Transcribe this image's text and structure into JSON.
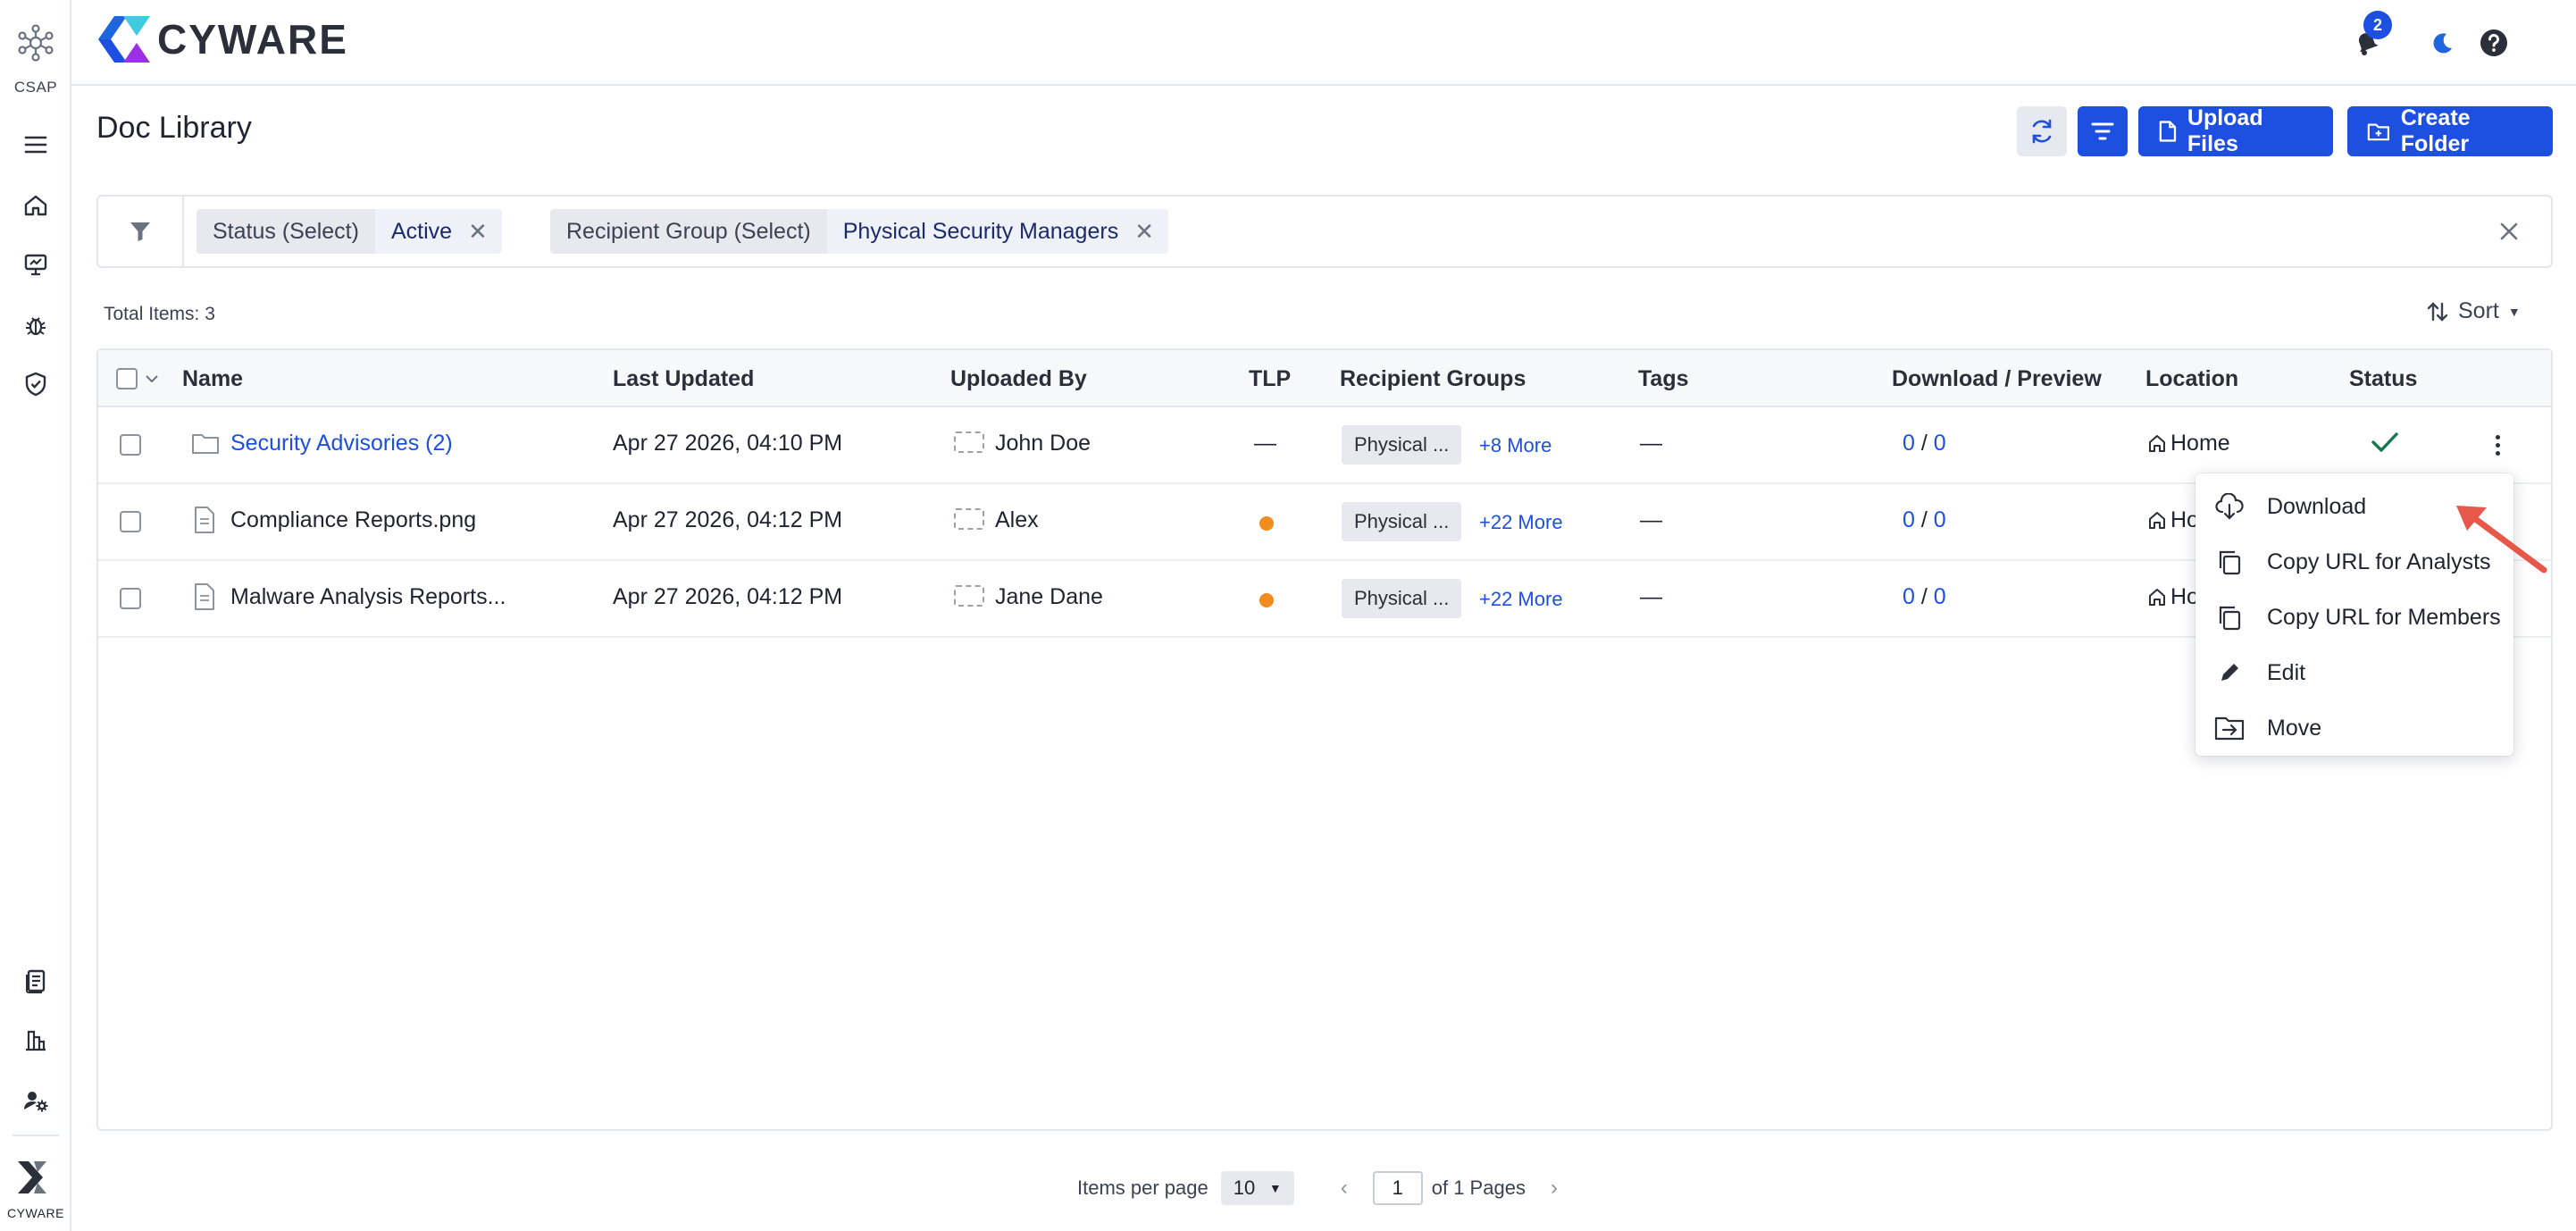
{
  "rail": {
    "app_name": "CSAP",
    "brand_name": "CYWARE"
  },
  "header": {
    "brand": "CYWARE",
    "notification_count": "2"
  },
  "page": {
    "title": "Doc Library",
    "upload_label": "Upload Files",
    "create_folder_label": "Create Folder"
  },
  "filters": [
    {
      "key": "Status (Select)",
      "value": "Active"
    },
    {
      "key": "Recipient Group (Select)",
      "value": "Physical Security Managers"
    }
  ],
  "total_items": "Total Items: 3",
  "sort_label": "Sort",
  "table": {
    "columns": [
      "Name",
      "Last Updated",
      "Uploaded By",
      "TLP",
      "Recipient Groups",
      "Tags",
      "Download / Preview",
      "Location",
      "Status"
    ],
    "rows": [
      {
        "name": "Security Advisories (2)",
        "type": "folder",
        "last_updated": "Apr 27 2026, 04:10 PM",
        "uploaded_by": "John Doe",
        "tlp": "—",
        "group": "Physical ...",
        "more": "+8 More",
        "tags": "—",
        "downloads": "0",
        "previews": "0",
        "location": "Home",
        "status": "active"
      },
      {
        "name": "Compliance Reports.png",
        "type": "file",
        "last_updated": "Apr 27 2026, 04:12 PM",
        "uploaded_by": "Alex",
        "tlp": "amber",
        "group": "Physical ...",
        "more": "+22 More",
        "tags": "—",
        "downloads": "0",
        "previews": "0",
        "location": "Ho",
        "status": ""
      },
      {
        "name": "Malware Analysis Reports...",
        "type": "file",
        "last_updated": "Apr 27 2026, 04:12 PM",
        "uploaded_by": "Jane Dane",
        "tlp": "amber",
        "group": "Physical ...",
        "more": "+22 More",
        "tags": "—",
        "downloads": "0",
        "previews": "0",
        "location": "Ho",
        "status": ""
      }
    ]
  },
  "context_menu": {
    "items": [
      "Download",
      "Copy URL for Analysts",
      "Copy URL for Members",
      "Edit",
      "Move"
    ]
  },
  "pagination": {
    "items_per_page_label": "Items per page",
    "items_per_page": "10",
    "current_page": "1",
    "of_pages": "of 1 Pages"
  },
  "colors": {
    "primary": "#1d4fe0",
    "tlp_amber": "#f28c1c",
    "status_green": "#16794c",
    "annotation_arrow": "#e8584a"
  }
}
